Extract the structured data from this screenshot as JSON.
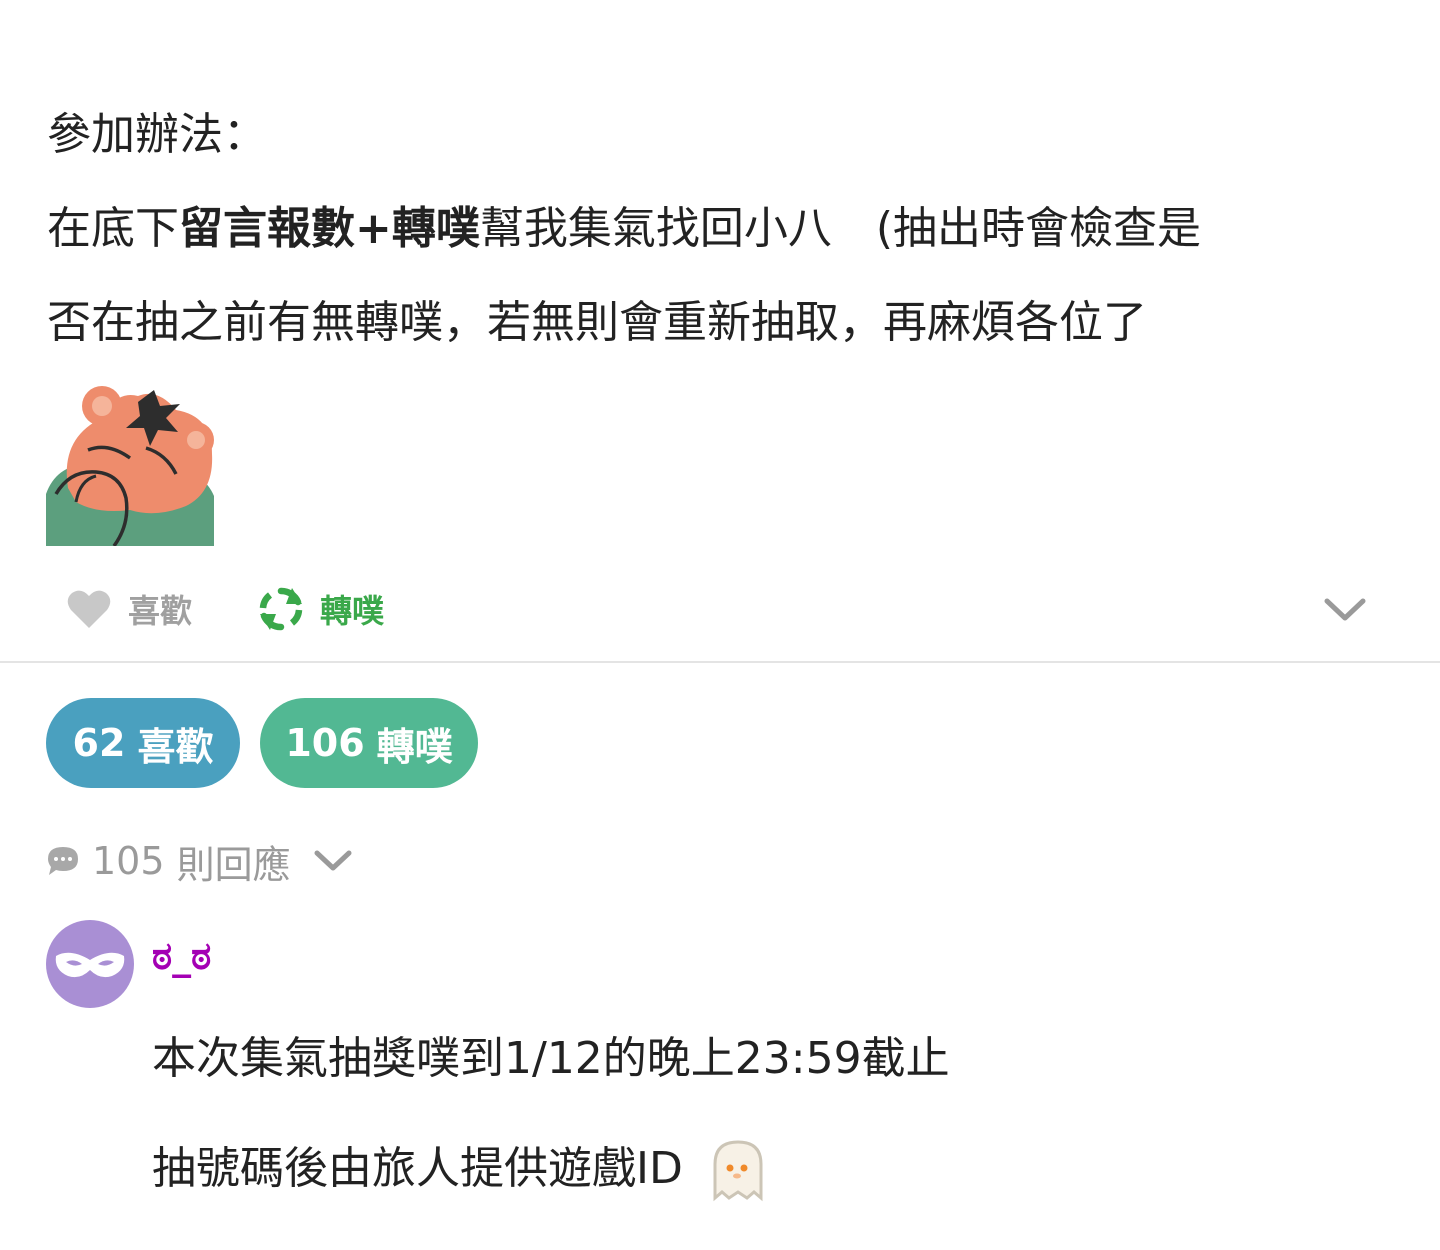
{
  "post": {
    "heading": "參加辦法：",
    "line2_prefix": "在底下",
    "line2_bold": "留言報數+轉噗",
    "line2_suffix": "幫我集氣找回小八　(抽出時會檢查是",
    "line3": "否在抽之前有無轉噗，若無則會重新抽取，再麻煩各位了"
  },
  "actions": {
    "like_label": "喜歡",
    "replurk_label": "轉噗"
  },
  "stats": {
    "likes_count": "62",
    "likes_label": "喜歡",
    "replurks_count": "106",
    "replurks_label": "轉噗"
  },
  "responses": {
    "count": "105",
    "label": "則回應"
  },
  "comment": {
    "username": "ಠ_ಠ",
    "line1": "本次集氣抽獎噗到1/12的晚上23:59截止",
    "line2": "抽號碼後由旅人提供遊戲ID"
  },
  "colors": {
    "likes_pill": "#4aa0bf",
    "replurks_pill": "#52b893",
    "replurk_green": "#3aa84a",
    "username_purple": "#a400b4",
    "avatar_bg": "#a98fd4"
  },
  "icons": {
    "like": "heart-icon",
    "replurk": "refresh-icon",
    "expand": "chevron-down-icon",
    "responses": "speech-bubble-icon",
    "avatar": "mask-icon",
    "emoji": "ghost-icon"
  }
}
